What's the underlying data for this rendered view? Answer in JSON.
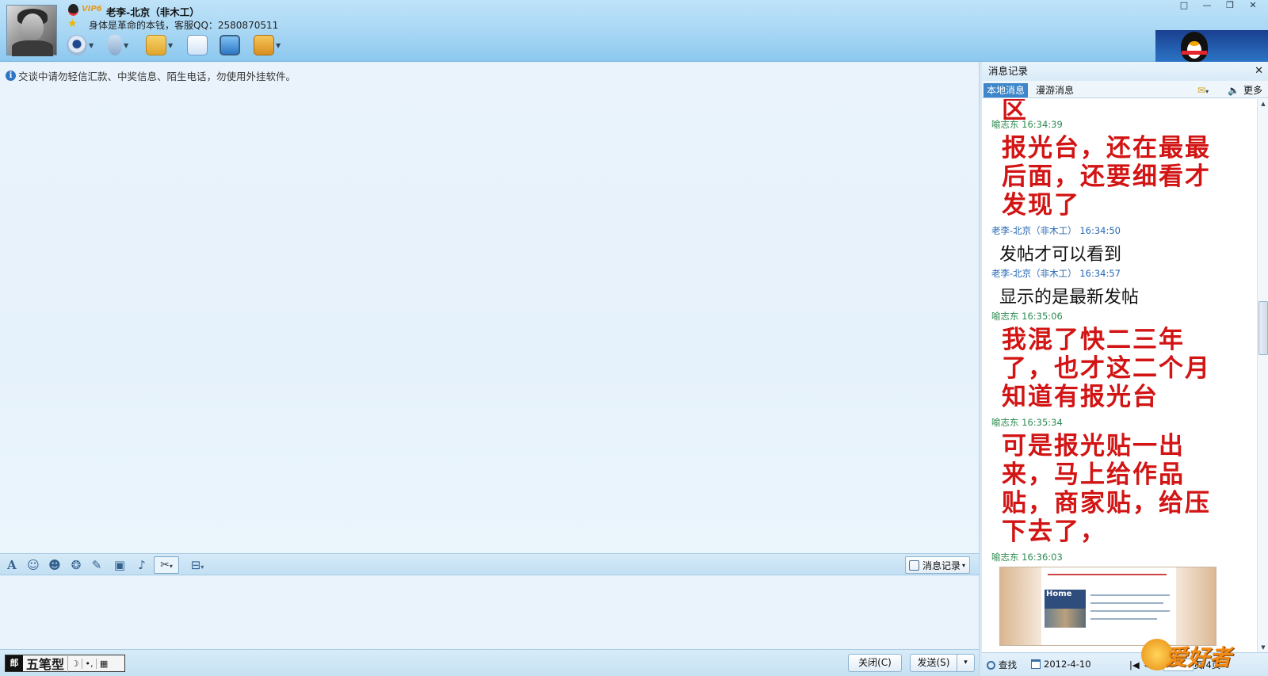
{
  "header": {
    "vip_badge": "VIP6",
    "contact_name": "老李-北京（非木工）",
    "signature": "身体是革命的本钱，客服QQ：2580870511",
    "toolbar_icons": [
      "webcam-icon",
      "microphone-icon",
      "send-file-icon",
      "group-message-icon",
      "remote-desktop-icon",
      "app-box-icon"
    ]
  },
  "window_controls": [
    "□",
    "—",
    "❐",
    "✕"
  ],
  "chat": {
    "notice": "交谈中请勿轻信汇款、中奖信息、陌生电话，勿使用外挂软件。"
  },
  "format_bar": {
    "history_button": "消息记录"
  },
  "ime": {
    "logo": "郎",
    "mode": "五笔型",
    "moon": "☽",
    "punct": "•,"
  },
  "bottom_buttons": {
    "close": "关闭(C)",
    "send": "发送(S)",
    "send_dropdown": "▾"
  },
  "history": {
    "title": "消息记录",
    "close": "✕",
    "tabs": [
      "本地消息",
      "漫游消息"
    ],
    "more": "更多",
    "top_fragment": "区",
    "messages": [
      {
        "sender": "喻志东",
        "time": "16:34:39",
        "text": "报光台，还在最最后面，还要细看才发现了",
        "style": "big-red",
        "name_color": "green"
      },
      {
        "sender": "老李-北京（非木工）",
        "time": "16:34:50",
        "text": "发帖才可以看到",
        "style": "plain",
        "name_color": "blue"
      },
      {
        "sender": "老李-北京（非木工）",
        "time": "16:34:57",
        "text": "显示的是最新发帖",
        "style": "plain",
        "name_color": "blue"
      },
      {
        "sender": "喻志东",
        "time": "16:35:06",
        "text": "我混了快二三年了，也才这二个月知道有报光台",
        "style": "big-red",
        "name_color": "green"
      },
      {
        "sender": "喻志东",
        "time": "16:35:34",
        "text": "可是报光贴一出来，马上给作品贴，商家贴，给压下去了，",
        "style": "big-red",
        "name_color": "green"
      },
      {
        "sender": "喻志东",
        "time": "16:36:03",
        "text": "",
        "style": "image",
        "name_color": "green"
      }
    ],
    "screenshot_label": "Home",
    "bottom": {
      "search": "查找",
      "date": "2012-4-10",
      "page_prefix": "第",
      "page_value": "4",
      "page_suffix": "页/4页"
    }
  },
  "watermark": "爱好者",
  "colors": {
    "red_text": "#d21414",
    "name_green": "#2c8a4f",
    "name_blue": "#2668b5",
    "tab_active": "#3d86c9"
  }
}
